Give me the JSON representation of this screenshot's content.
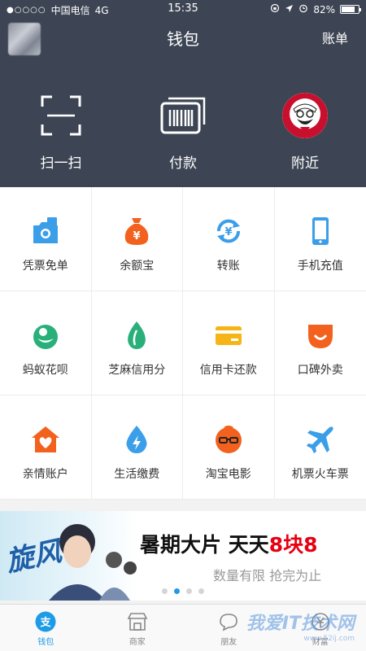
{
  "status": {
    "signal": "●○○○○",
    "carrier": "中国电信",
    "network": "4G",
    "time": "15:35",
    "battery": "82%",
    "battery_level": 0.82
  },
  "nav": {
    "title": "钱包",
    "bill": "账单"
  },
  "quick": [
    {
      "label": "扫一扫",
      "icon": "scan-icon"
    },
    {
      "label": "付款",
      "icon": "barcode-pay-icon"
    },
    {
      "label": "附近",
      "icon": "kfc-logo"
    }
  ],
  "grid": [
    {
      "label": "凭票免单",
      "icon": "ticket-camera-icon",
      "color": "#3b9ee8"
    },
    {
      "label": "余额宝",
      "icon": "money-bag-icon",
      "color": "#f2611d"
    },
    {
      "label": "转账",
      "icon": "transfer-icon",
      "color": "#3b9ee8"
    },
    {
      "label": "手机充值",
      "icon": "phone-icon",
      "color": "#3b9ee8"
    },
    {
      "label": "蚂蚁花呗",
      "icon": "huabei-icon",
      "color": "#29b07a"
    },
    {
      "label": "芝麻信用分",
      "icon": "sesame-icon",
      "color": "#29b07a"
    },
    {
      "label": "信用卡还款",
      "icon": "credit-card-icon",
      "color": "#f5b516"
    },
    {
      "label": "口碑外卖",
      "icon": "takeout-icon",
      "color": "#f2611d"
    },
    {
      "label": "亲情账户",
      "icon": "family-house-icon",
      "color": "#f2611d"
    },
    {
      "label": "生活缴费",
      "icon": "utility-drop-icon",
      "color": "#3b9ee8"
    },
    {
      "label": "淘宝电影",
      "icon": "movie-icon",
      "color": "#f2611d"
    },
    {
      "label": "机票火车票",
      "icon": "plane-icon",
      "color": "#3b9ee8"
    }
  ],
  "banner": {
    "title_main": "暑期大片 天天",
    "title_highlight": "8块8",
    "subtitle": "数量有限  抢完为止",
    "art_text": "旋风"
  },
  "tabs": [
    {
      "label": "钱包",
      "icon": "wallet-tab-icon",
      "active": true
    },
    {
      "label": "商家",
      "icon": "shop-tab-icon",
      "active": false
    },
    {
      "label": "朋友",
      "icon": "friends-tab-icon",
      "active": false
    },
    {
      "label": "财富",
      "icon": "wealth-tab-icon",
      "active": false
    }
  ],
  "watermark": {
    "text": "我爱IT技术网",
    "url": "www.52ij.com"
  },
  "colors": {
    "header_bg": "#3d4554",
    "accent": "#1e9be8",
    "highlight": "#e60012"
  }
}
